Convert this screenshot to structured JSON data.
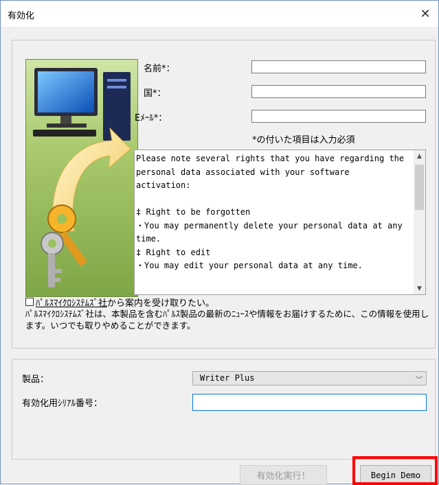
{
  "window": {
    "title": "有効化",
    "close_glyph": "✕"
  },
  "form": {
    "name_label": "名前*：",
    "country_label": "国*：",
    "email_label": "Eﾒｰﾙ*：",
    "name_value": "",
    "country_value": "",
    "email_value": "",
    "required_note": "*の付いた項目は入力必須"
  },
  "privacy_text": "Please note several rights that you have regarding the\npersonal data associated with your software activation:\n\n‡ Right to be forgotten\n・You may permanently delete your personal data at any time.\n‡ Right to edit\n・You may edit your personal data at any time.",
  "optin": {
    "label_link": "ﾊﾟﾙｽﾏｲｸﾛｼｽﾃﾑｽﾞ社",
    "label_rest": "から案内を受け取りたい。",
    "checked": false,
    "description": "ﾊﾟﾙｽﾏｲｸﾛｼｽﾃﾑｽﾞ社は、本製品を含むﾊﾟﾙｽ製品の最新のﾆｭｰｽや情報をお届けするために、この情報を使用します。いつでも取りやめることができます。"
  },
  "product": {
    "label": "製品：",
    "selected": "Writer Plus",
    "serial_label": "有効化用ｼﾘｱﾙ番号：",
    "serial_value": ""
  },
  "buttons": {
    "activate": "有効化実行！",
    "begin_demo": "Begin Demo"
  },
  "colors": {
    "highlight": "#ff0000",
    "focus_border": "#0078d7",
    "art_border": "#6d8c3e"
  },
  "icons": [
    "close-icon",
    "computer-icon",
    "keys-icon",
    "arrow-icon",
    "chevron-up-icon",
    "chevron-down-icon",
    "dropdown-chevron-icon"
  ]
}
